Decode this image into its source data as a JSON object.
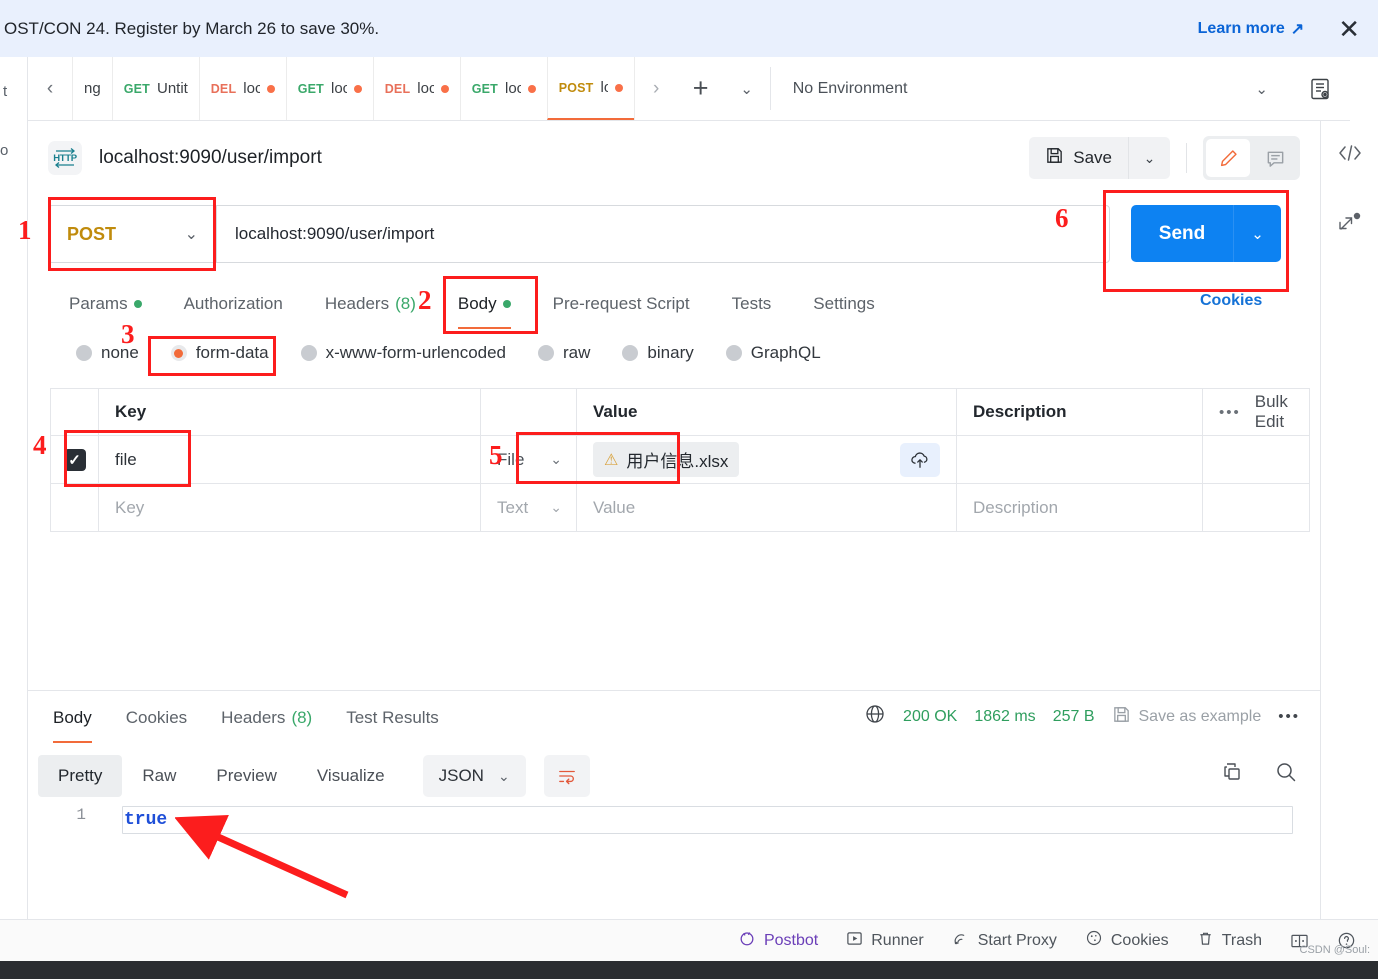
{
  "banner": {
    "text": "OST/CON 24. Register by March 26 to save 30%.",
    "link": "Learn more",
    "link_icon": "external-link-icon",
    "close_icon": "close-icon"
  },
  "left_rail": {
    "stub_top": "t",
    "stub_bottom": "o"
  },
  "tabstrip": {
    "nav_left_icon": "chevron-left-icon",
    "nav_right_icon": "chevron-right-icon",
    "plus_label": "+",
    "caret_label": "⌄",
    "tabs": [
      {
        "method": "",
        "name": "ng",
        "dirty": false,
        "active": false
      },
      {
        "method": "GET",
        "name": "Untitle",
        "dirty": false,
        "active": false
      },
      {
        "method": "DEL",
        "name": "localh",
        "dirty": true,
        "active": false
      },
      {
        "method": "GET",
        "name": "locall",
        "dirty": true,
        "active": false
      },
      {
        "method": "DEL",
        "name": "localh",
        "dirty": true,
        "active": false
      },
      {
        "method": "GET",
        "name": "locall",
        "dirty": true,
        "active": false
      },
      {
        "method": "POST",
        "name": "loca",
        "dirty": true,
        "active": true
      }
    ],
    "environment": "No Environment",
    "env_caret_icon": "chevron-down-icon",
    "env_eye_icon": "environment-quick-look-icon"
  },
  "request_header": {
    "protocol_badge": "HTTP",
    "title": "localhost:9090/user/import",
    "save_label": "Save",
    "save_icon": "floppy-disk-icon",
    "save_caret_icon": "chevron-down-icon",
    "edit_icon": "pencil-icon",
    "comment_icon": "comment-icon"
  },
  "right_rail": {
    "code_icon": "code-snippet-icon",
    "resize_icon": "expand-collapse-icon"
  },
  "url_bar": {
    "method": "POST",
    "method_caret_icon": "chevron-down-icon",
    "url": "localhost:9090/user/import",
    "send_label": "Send",
    "send_caret_icon": "chevron-down-icon",
    "cookies_label": "Cookies"
  },
  "request_tabs": [
    {
      "label": "Params",
      "dot": true,
      "count": null,
      "active": false
    },
    {
      "label": "Authorization",
      "dot": false,
      "count": null,
      "active": false
    },
    {
      "label": "Headers",
      "dot": false,
      "count": "(8)",
      "active": false
    },
    {
      "label": "Body",
      "dot": true,
      "count": null,
      "active": true
    },
    {
      "label": "Pre-request Script",
      "dot": false,
      "count": null,
      "active": false
    },
    {
      "label": "Tests",
      "dot": false,
      "count": null,
      "active": false
    },
    {
      "label": "Settings",
      "dot": false,
      "count": null,
      "active": false
    }
  ],
  "body_types": [
    {
      "label": "none",
      "selected": false
    },
    {
      "label": "form-data",
      "selected": true
    },
    {
      "label": "x-www-form-urlencoded",
      "selected": false
    },
    {
      "label": "raw",
      "selected": false
    },
    {
      "label": "binary",
      "selected": false
    },
    {
      "label": "GraphQL",
      "selected": false
    }
  ],
  "params_table": {
    "headers": {
      "key": "Key",
      "value": "Value",
      "description": "Description",
      "bulk_edit": "Bulk Edit",
      "dots_icon": "more-options-icon"
    },
    "rows": [
      {
        "checked": true,
        "key": "file",
        "type": "File",
        "value": "用户信息.xlsx",
        "value_warning_icon": "warning-triangle-icon",
        "upload_icon": "cloud-upload-icon",
        "description": "",
        "placeholder": false
      },
      {
        "checked": false,
        "key": "Key",
        "type": "Text",
        "value": "Value",
        "description": "Description",
        "placeholder": true
      }
    ]
  },
  "response": {
    "tabs": [
      {
        "label": "Body",
        "count": null,
        "active": true
      },
      {
        "label": "Cookies",
        "count": null,
        "active": false
      },
      {
        "label": "Headers",
        "count": "(8)",
        "active": false
      },
      {
        "label": "Test Results",
        "count": null,
        "active": false
      }
    ],
    "globe_icon": "globe-icon",
    "status": "200 OK",
    "time": "1862 ms",
    "size": "257 B",
    "save_example": "Save as example",
    "save_example_icon": "floppy-disk-icon",
    "more_icon": "more-options-icon",
    "formats": [
      {
        "label": "Pretty",
        "active": true
      },
      {
        "label": "Raw",
        "active": false
      },
      {
        "label": "Preview",
        "active": false
      },
      {
        "label": "Visualize",
        "active": false
      }
    ],
    "language": "JSON",
    "language_caret_icon": "chevron-down-icon",
    "wrap_icon": "wrap-lines-icon",
    "copy_icon": "copy-icon",
    "search_icon": "search-icon",
    "line_number": "1",
    "body_text": "true"
  },
  "footer": {
    "items": [
      {
        "label": "Postbot",
        "icon": "postbot-icon"
      },
      {
        "label": "Runner",
        "icon": "runner-icon"
      },
      {
        "label": "Start Proxy",
        "icon": "proxy-icon"
      },
      {
        "label": "Cookies",
        "icon": "cookie-icon"
      },
      {
        "label": "Trash",
        "icon": "trash-icon"
      },
      {
        "label": "",
        "icon": "two-pane-icon"
      },
      {
        "label": "",
        "icon": "help-icon"
      }
    ]
  },
  "watermark": "CSDN @Soul:",
  "annotations": {
    "n1": "1",
    "n2": "2",
    "n3": "3",
    "n4": "4",
    "n5": "5",
    "n6": "6"
  }
}
